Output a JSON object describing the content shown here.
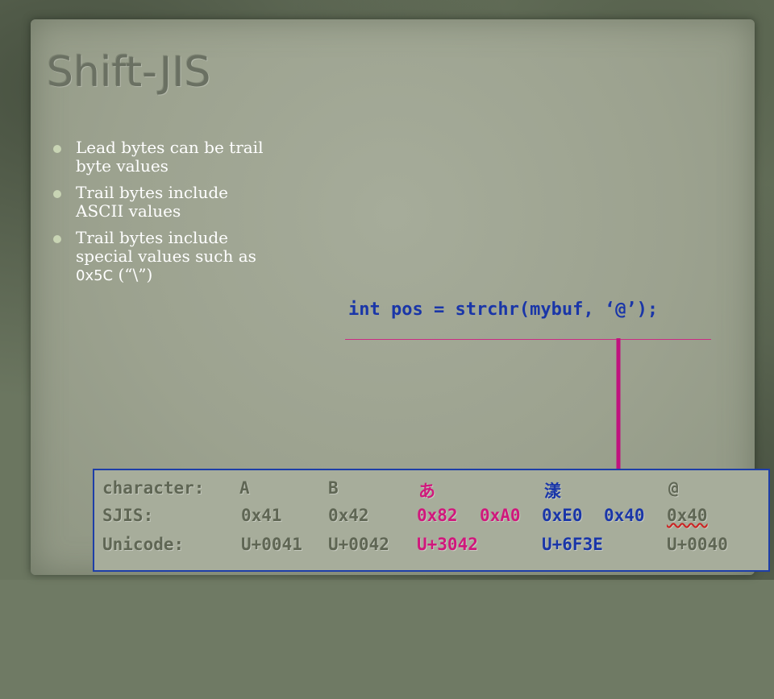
{
  "slide": {
    "title": "Shift-JIS",
    "bullets": [
      {
        "text": "Lead bytes can be trail byte values"
      },
      {
        "text": "Trail bytes include ASCII values"
      },
      {
        "text_prefix": "Trail bytes include special values such as ",
        "code": "0x5C",
        "text_suffix": " (“\\”)"
      }
    ],
    "code_line": "int pos = strchr(mybuf, ‘@’);",
    "table": {
      "character": {
        "label": "character:",
        "cells": [
          "A",
          "B",
          "あ",
          "漾",
          "@"
        ]
      },
      "sjis": {
        "label": "SJIS:",
        "cells": [
          "0x41",
          "0x42",
          "0x82",
          "0xA0",
          "0xE0",
          "0x40",
          "0x40"
        ]
      },
      "unicode": {
        "label": "Unicode:",
        "cells": [
          "U+0041",
          "U+0042",
          "U+3042",
          "U+6F3E",
          "U+0040"
        ]
      }
    },
    "colors": {
      "accent_pink": "#d0187c",
      "accent_blue": "#1a36a8",
      "muted_text": "#5f6654",
      "panel": "#9ca28f"
    },
    "icons": {
      "bullet": "round-bullet-icon",
      "pointer": "down-arrow-icon"
    }
  }
}
